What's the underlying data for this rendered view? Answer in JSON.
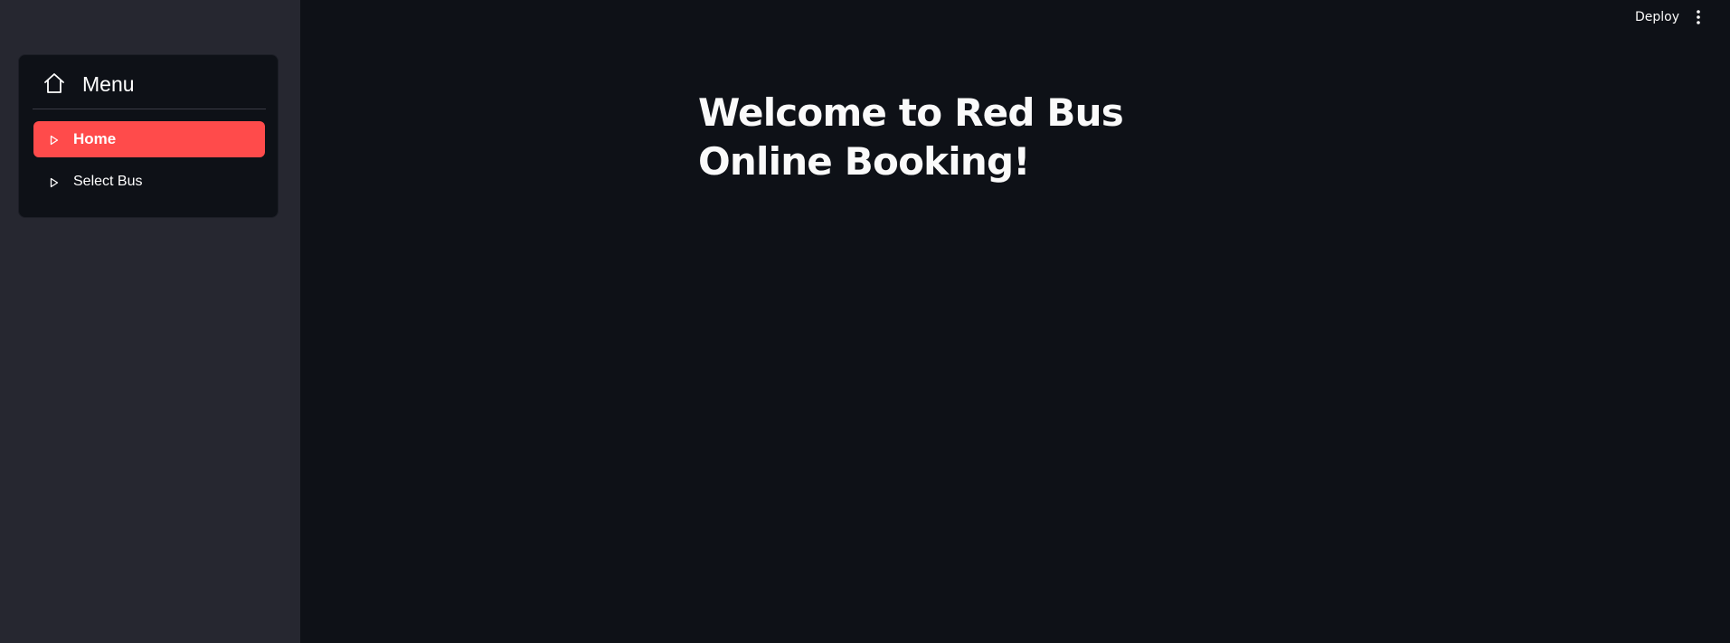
{
  "sidebar": {
    "menu_title": "Menu",
    "menu_icon": "home-icon",
    "items": [
      {
        "label": "Home",
        "icon": "play-outline-icon",
        "active": true
      },
      {
        "label": "Select Bus",
        "icon": "play-outline-icon",
        "active": false
      }
    ]
  },
  "toolbar": {
    "deploy_label": "Deploy",
    "more_icon": "kebab-menu-icon"
  },
  "main": {
    "title": "Welcome to Red Bus Online Booking!"
  },
  "colors": {
    "accent": "#ff4b4b",
    "background": "#0e1117",
    "sidebar_background": "#262730",
    "text": "#fafafa"
  }
}
